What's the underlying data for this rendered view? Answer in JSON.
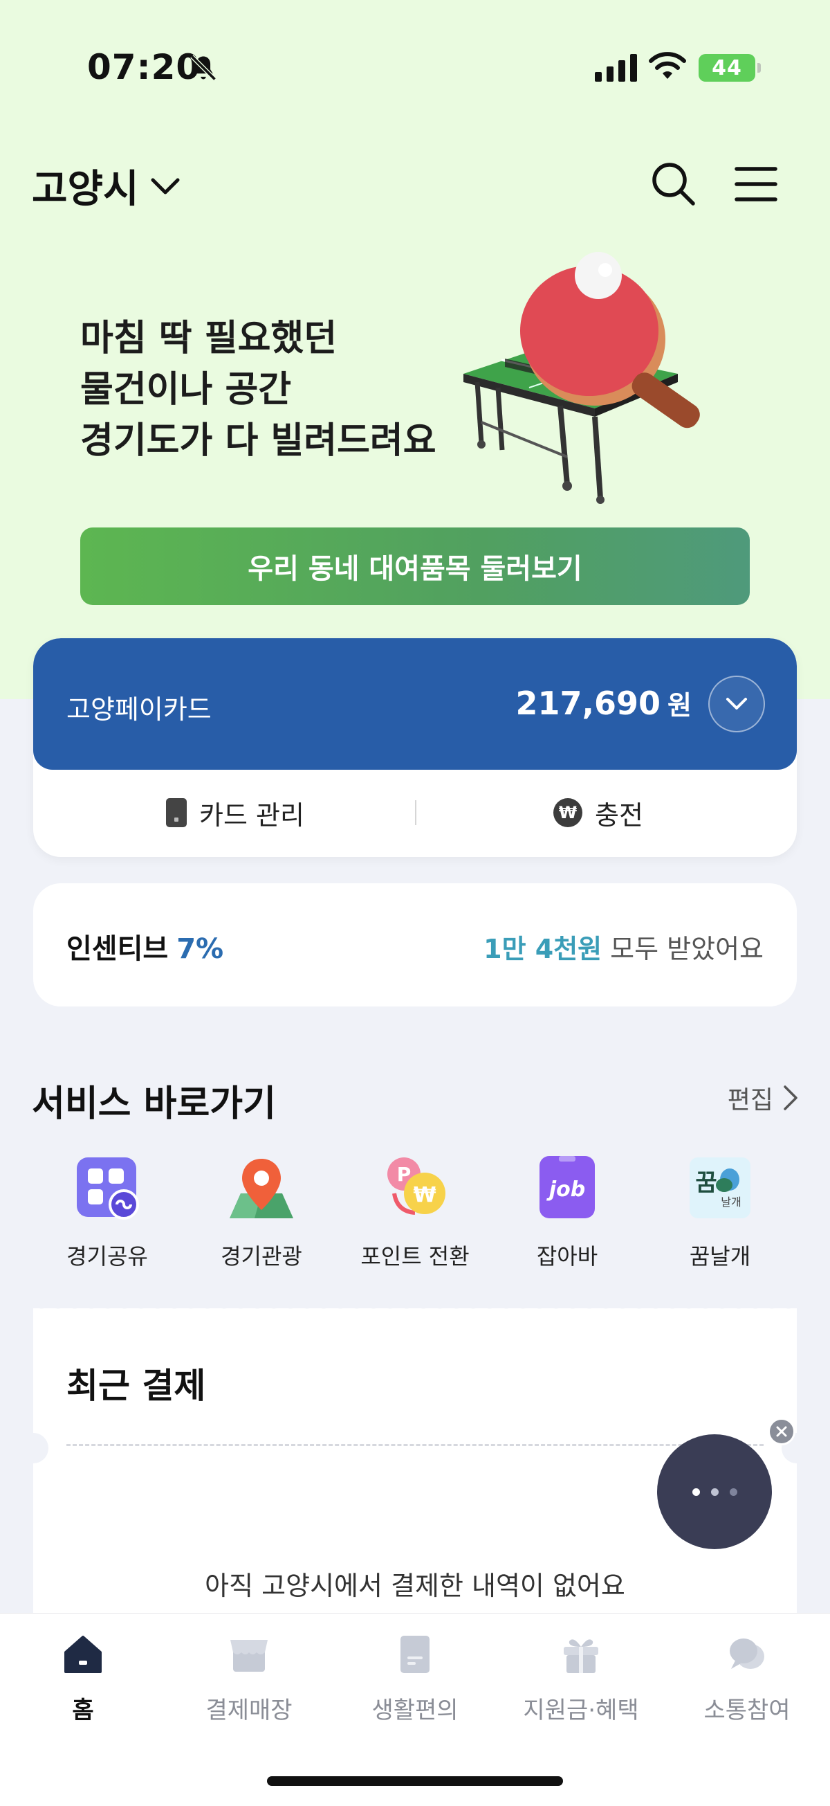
{
  "status_bar": {
    "time": "07:20",
    "battery": "44"
  },
  "header": {
    "city": "고양시"
  },
  "hero": {
    "lines": [
      "마침 딱 필요했던",
      "물건이나 공간",
      "경기도가 다 빌려드려요"
    ],
    "button_label": "우리 동네 대여품목 둘러보기"
  },
  "card": {
    "name": "고양페이카드",
    "amount": "217,690",
    "currency": "원",
    "manage_label": "카드 관리",
    "charge_label": "충전"
  },
  "incentive": {
    "label": "인센티브",
    "percent": "7%",
    "amount": "1만 4천원",
    "suffix": "모두 받았어요"
  },
  "services": {
    "title": "서비스 바로가기",
    "edit_label": "편집",
    "items": [
      {
        "label": "경기공유",
        "icon": "share-icon"
      },
      {
        "label": "경기관광",
        "icon": "map-pin-icon"
      },
      {
        "label": "포인트 전환",
        "icon": "point-convert-icon"
      },
      {
        "label": "잡아바",
        "icon": "job-icon"
      },
      {
        "label": "꿈날개",
        "icon": "dream-wing-icon"
      }
    ]
  },
  "recent": {
    "title": "최근 결제",
    "empty_message": "아직 고양시에서 결제한 내역이 없어요"
  },
  "bottom_nav": {
    "items": [
      {
        "label": "홈",
        "icon": "home-icon",
        "active": true
      },
      {
        "label": "결제매장",
        "icon": "store-icon",
        "active": false
      },
      {
        "label": "생활편의",
        "icon": "document-icon",
        "active": false
      },
      {
        "label": "지원금·혜택",
        "icon": "gift-icon",
        "active": false
      },
      {
        "label": "소통참여",
        "icon": "chat-icon",
        "active": false
      }
    ]
  },
  "colors": {
    "hero_bg": "#eafbe0",
    "card_blue": "#285da8",
    "accent_green": "#5db651",
    "incentive_blue": "#2b6cb0",
    "incentive_teal": "#3a9db8"
  }
}
